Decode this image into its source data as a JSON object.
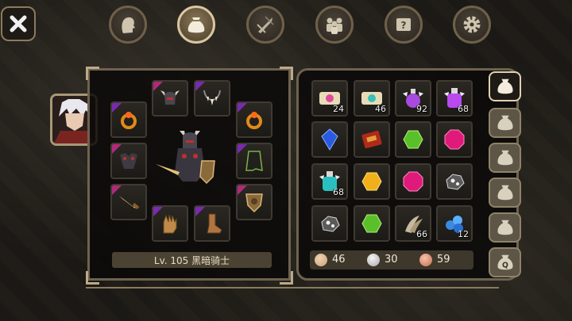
{
  "top_tabs": [
    {
      "icon": "character-head-icon",
      "active": false
    },
    {
      "icon": "bag-icon",
      "active": true
    },
    {
      "icon": "skill-sword-icon",
      "active": false
    },
    {
      "icon": "party-icon",
      "active": false
    },
    {
      "icon": "quest-scroll-icon",
      "active": false
    },
    {
      "icon": "settings-gear-icon",
      "active": false
    }
  ],
  "character": {
    "level_label": "Lv. 105 黑暗骑士"
  },
  "equipment": [
    {
      "icon": "horned-helmet-icon",
      "rarity": "#b02a7a"
    },
    {
      "icon": "fang-necklace-icon",
      "rarity": "#7a2ab0"
    },
    {
      "icon": "amber-ring-icon",
      "rarity": "#7a2ab0"
    },
    {
      "icon": "amber-ring-icon",
      "rarity": "#7a2ab0"
    },
    {
      "icon": "dark-armor-icon",
      "rarity": "#b02a7a"
    },
    {
      "icon": "green-cape-icon",
      "rarity": "#7a2ab0"
    },
    {
      "icon": "golden-sword-icon",
      "rarity": "#b02a7a"
    },
    {
      "icon": "bronze-shield-icon",
      "rarity": "#b02a7a"
    },
    {
      "icon": "gauntlet-icon",
      "rarity": "#7a2ab0"
    },
    {
      "icon": "leather-boots-icon",
      "rarity": "#7a2ab0"
    }
  ],
  "inventory": [
    {
      "icon": "pink-scroll-icon",
      "qty": "24"
    },
    {
      "icon": "teal-scroll-icon",
      "qty": "46"
    },
    {
      "icon": "purple-potion-icon",
      "qty": "92"
    },
    {
      "icon": "purple-potion-large-icon",
      "qty": "68"
    },
    {
      "icon": "blue-gem-icon",
      "qty": ""
    },
    {
      "icon": "red-tome-icon",
      "qty": ""
    },
    {
      "icon": "green-gem-icon",
      "qty": ""
    },
    {
      "icon": "pink-gem-icon",
      "qty": ""
    },
    {
      "icon": "teal-potion-icon",
      "qty": "68"
    },
    {
      "icon": "yellow-gem-icon",
      "qty": ""
    },
    {
      "icon": "pink-gem-icon",
      "qty": ""
    },
    {
      "icon": "ore-icon",
      "qty": ""
    },
    {
      "icon": "ore-icon",
      "qty": ""
    },
    {
      "icon": "green-gem-icon",
      "qty": ""
    },
    {
      "icon": "claw-material-icon",
      "qty": "66"
    },
    {
      "icon": "blue-crystal-cluster-icon",
      "qty": "12"
    }
  ],
  "currency": [
    {
      "icon": "bronze-coin-icon",
      "value": "46",
      "color": "#c9a27a"
    },
    {
      "icon": "silver-coin-icon",
      "value": "30",
      "color": "#c8c8c8"
    },
    {
      "icon": "copper-coin-icon",
      "value": "59",
      "color": "#d08a6a"
    }
  ],
  "side_tabs": [
    {
      "icon": "bag-icon",
      "active": true
    },
    {
      "icon": "bag-icon",
      "active": false
    },
    {
      "icon": "bag-icon",
      "active": false
    },
    {
      "icon": "bag-icon",
      "active": false
    },
    {
      "icon": "bag-icon",
      "active": false
    },
    {
      "icon": "quest-bag-icon",
      "active": false,
      "label": "Q"
    }
  ]
}
